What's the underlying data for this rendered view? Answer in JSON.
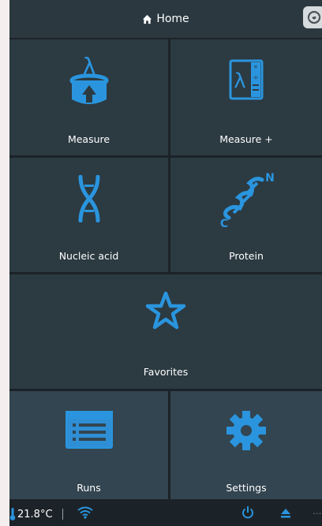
{
  "header": {
    "title": "Home",
    "home_icon": "home-icon",
    "logo_icon": "brand-logo-icon"
  },
  "tiles": {
    "measure": {
      "label": "Measure",
      "icon": "lambda-cylinder-upload-icon"
    },
    "measure_plus": {
      "label": "Measure +",
      "icon": "lambda-calculator-icon"
    },
    "nucleic_acid": {
      "label": "Nucleic acid",
      "icon": "dna-icon"
    },
    "protein": {
      "label": "Protein",
      "icon": "protein-helix-icon",
      "n_label": "N",
      "c_label": "C"
    },
    "favorites": {
      "label": "Favorites",
      "icon": "star-icon"
    },
    "runs": {
      "label": "Runs",
      "icon": "list-icon"
    },
    "settings": {
      "label": "Settings",
      "icon": "gear-icon"
    }
  },
  "status": {
    "temperature": "21.8°C",
    "more": "...",
    "colors": {
      "accent": "#2a95de",
      "tile": "#2c3a42",
      "background": "#1c2328"
    }
  }
}
